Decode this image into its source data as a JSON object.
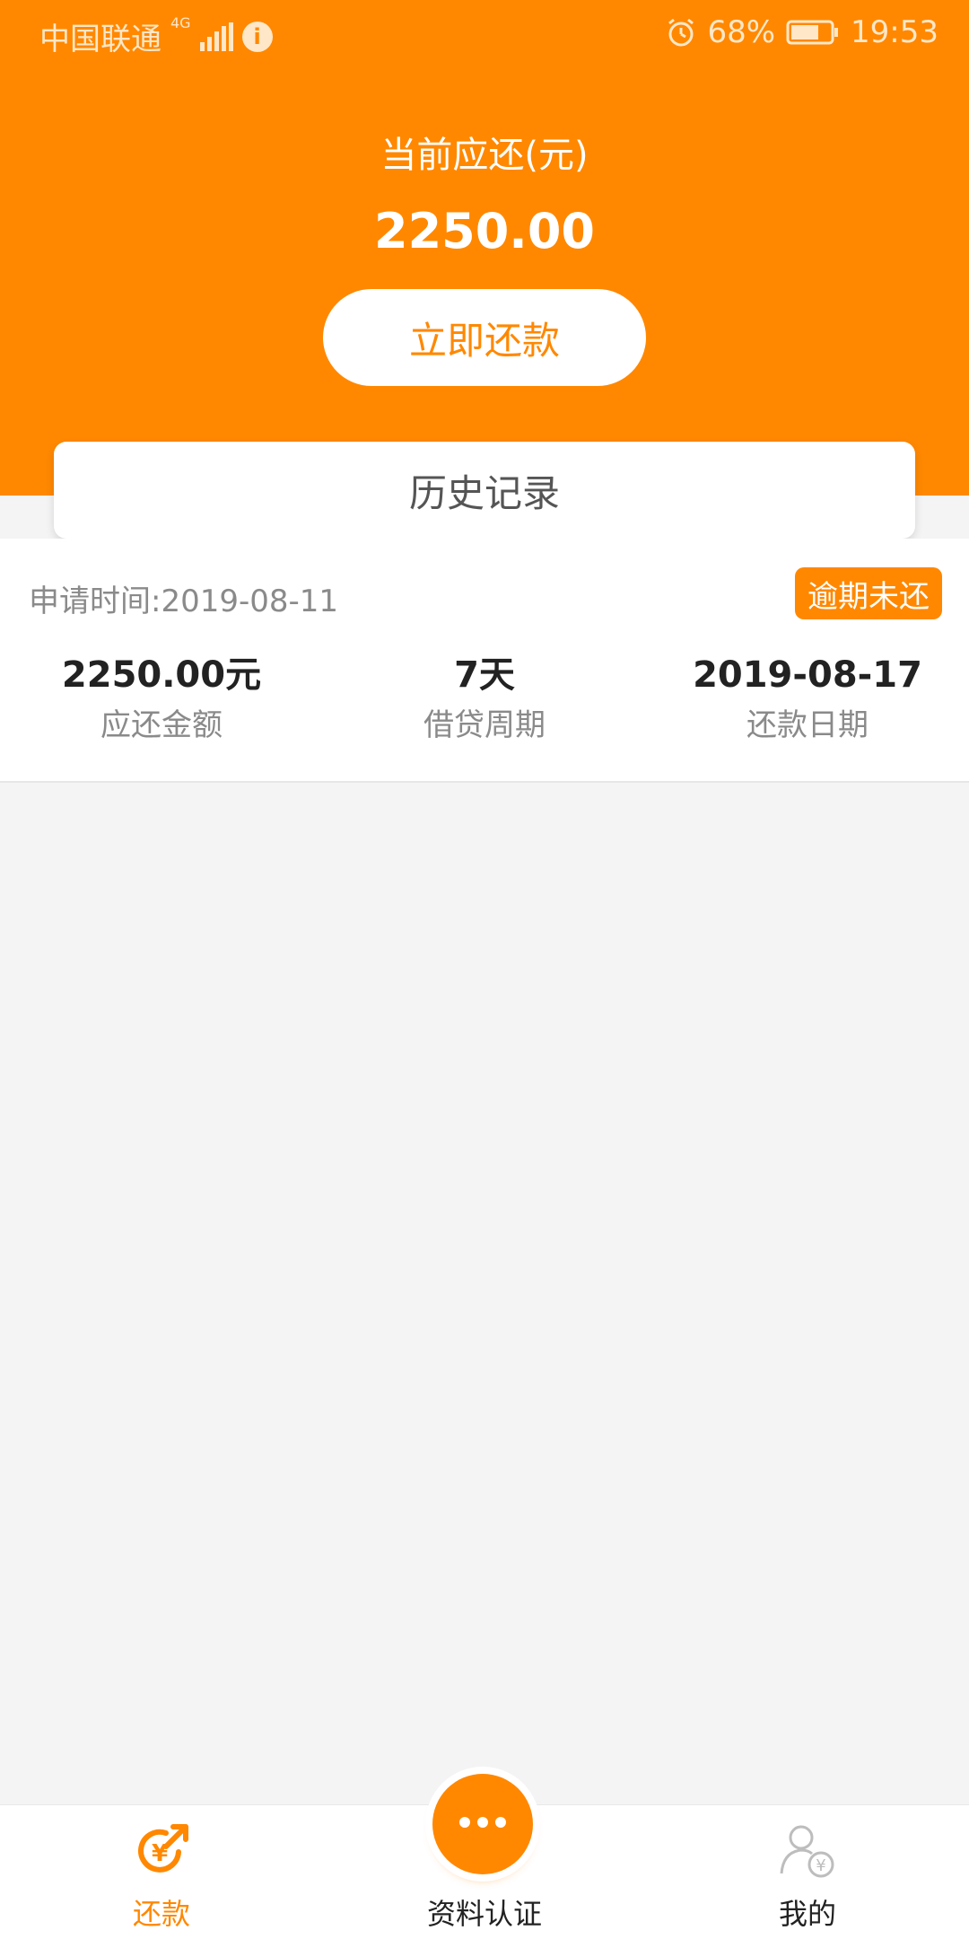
{
  "status_bar": {
    "carrier": "中国联通",
    "network": "4G",
    "battery": "68%",
    "time": "19:53"
  },
  "header": {
    "title": "当前应还(元)",
    "amount": "2250.00",
    "pay_button": "立即还款"
  },
  "history_tab": "历史记录",
  "record": {
    "apply_time": "申请时间:2019-08-11",
    "status_badge": "逾期未还",
    "stats": [
      {
        "value": "2250.00元",
        "label": "应还金额"
      },
      {
        "value": "7天",
        "label": "借贷周期"
      },
      {
        "value": "2019-08-17",
        "label": "还款日期"
      }
    ]
  },
  "bottom_nav": {
    "items": [
      {
        "label": "还款",
        "icon": "repay-yen-icon"
      },
      {
        "label": "资料认证",
        "icon": "more-dots-icon"
      },
      {
        "label": "我的",
        "icon": "user-yen-icon"
      }
    ]
  },
  "colors": {
    "accent": "#ff8800",
    "background": "#f4f4f4",
    "text_dark": "#222222",
    "text_gray": "#8a8a8a"
  }
}
